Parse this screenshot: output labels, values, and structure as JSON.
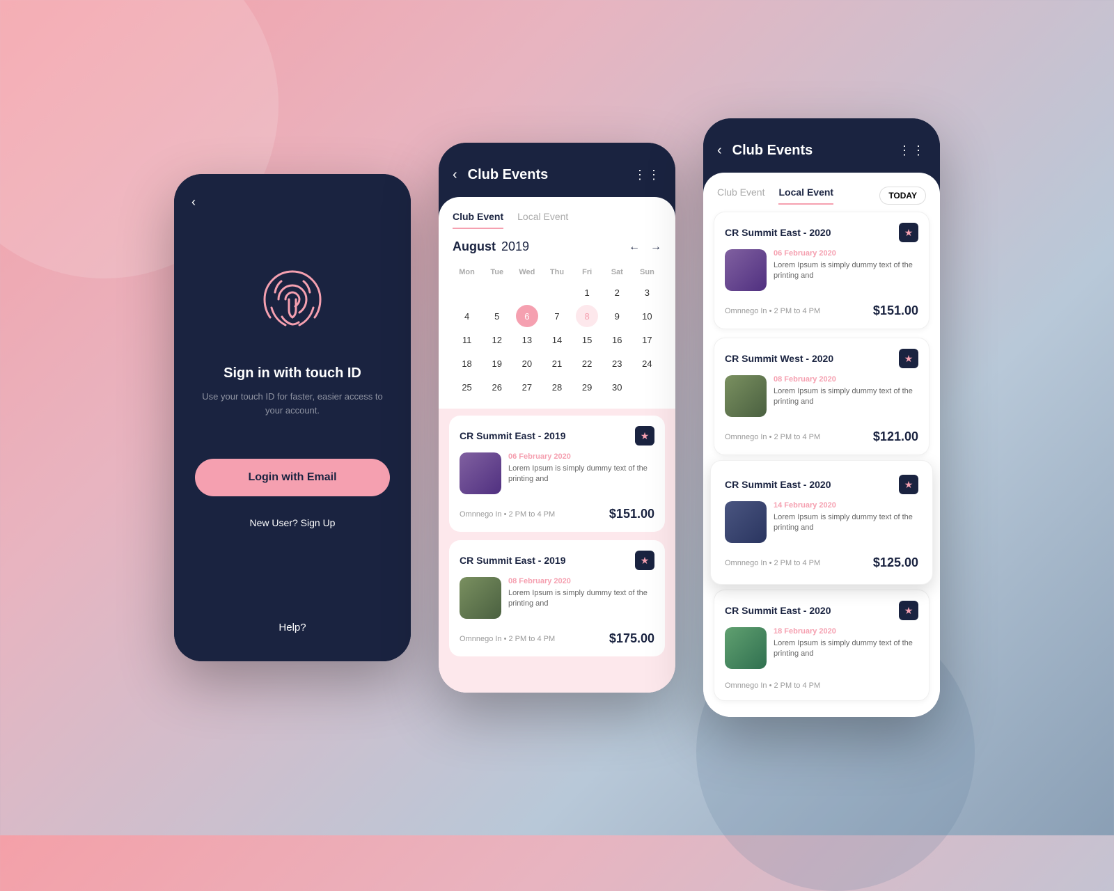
{
  "phone1": {
    "back_label": "‹",
    "sign_in_title": "Sign in with touch ID",
    "sign_in_subtitle": "Use your touch ID for faster, easier\naccess to your account.",
    "login_button": "Login with Email",
    "new_user_link": "New User? Sign Up",
    "help_link": "Help?"
  },
  "phone2": {
    "header": {
      "back": "‹",
      "title": "Club Events",
      "dots": "⋮⋮"
    },
    "tabs": [
      "Club Event",
      "Local Event"
    ],
    "calendar": {
      "month": "August",
      "year": "2019",
      "weekdays": [
        "Mon",
        "Tue",
        "Wed",
        "Thu",
        "Fri",
        "Sat",
        "Sun"
      ],
      "days": [
        {
          "day": "",
          "type": "empty"
        },
        {
          "day": "",
          "type": "empty"
        },
        {
          "day": "",
          "type": "empty"
        },
        {
          "day": "",
          "type": "empty"
        },
        {
          "day": "1",
          "type": "normal"
        },
        {
          "day": "2",
          "type": "normal"
        },
        {
          "day": "3",
          "type": "normal"
        },
        {
          "day": "4",
          "type": "normal"
        },
        {
          "day": "5",
          "type": "normal"
        },
        {
          "day": "6",
          "type": "highlighted"
        },
        {
          "day": "7",
          "type": "normal"
        },
        {
          "day": "8",
          "type": "highlighted-light"
        },
        {
          "day": "9",
          "type": "normal"
        },
        {
          "day": "10",
          "type": "normal"
        },
        {
          "day": "11",
          "type": "normal"
        },
        {
          "day": "12",
          "type": "normal"
        },
        {
          "day": "13",
          "type": "normal"
        },
        {
          "day": "14",
          "type": "normal"
        },
        {
          "day": "15",
          "type": "normal"
        },
        {
          "day": "16",
          "type": "normal"
        },
        {
          "day": "17",
          "type": "normal"
        },
        {
          "day": "18",
          "type": "normal"
        },
        {
          "day": "19",
          "type": "normal"
        },
        {
          "day": "20",
          "type": "normal"
        },
        {
          "day": "21",
          "type": "normal"
        },
        {
          "day": "22",
          "type": "normal"
        },
        {
          "day": "23",
          "type": "normal"
        },
        {
          "day": "24",
          "type": "normal"
        },
        {
          "day": "25",
          "type": "normal"
        },
        {
          "day": "26",
          "type": "normal"
        },
        {
          "day": "27",
          "type": "normal"
        },
        {
          "day": "28",
          "type": "normal"
        },
        {
          "day": "29",
          "type": "normal"
        },
        {
          "day": "30",
          "type": "normal"
        }
      ]
    },
    "events": [
      {
        "title": "CR Summit East - 2019",
        "date": "06 February 2020",
        "desc": "Lorem Ipsum is simply dummy text of the printing and",
        "location": "Omnnego In  •  2 PM to 4 PM",
        "price": "$151.00",
        "img_type": "crowd"
      },
      {
        "title": "CR Summit East - 2019",
        "date": "08 February 2020",
        "desc": "Lorem Ipsum is simply dummy text of the printing and",
        "location": "Omnnego In  •  2 PM to 4 PM",
        "price": "$175.00",
        "img_type": "outdoor"
      }
    ]
  },
  "phone3": {
    "header": {
      "back": "‹",
      "title": "Club Events",
      "dots": "⋮⋮"
    },
    "tabs": [
      "Club Event",
      "Local Event"
    ],
    "today_btn": "TODAY",
    "events": [
      {
        "title": "CR Summit East - 2020",
        "date": "06 February 2020",
        "desc": "Lorem Ipsum is simply dummy text of the printing and",
        "location": "Omnnego In  •  2 PM to 4 PM",
        "price": "$151.00",
        "img_type": "crowd",
        "elevated": false
      },
      {
        "title": "CR Summit West - 2020",
        "date": "08 February 2020",
        "desc": "Lorem Ipsum is simply dummy text of the printing and",
        "location": "Omnnego In  •  2 PM to 4 PM",
        "price": "$121.00",
        "img_type": "outdoor",
        "elevated": false
      },
      {
        "title": "CR Summit East - 2020",
        "date": "14 February 2020",
        "desc": "Lorem Ipsum is simply dummy text of the printing and",
        "location": "Omnnego In  •  2 PM to 4 PM",
        "price": "$125.00",
        "img_type": "dark",
        "elevated": true
      },
      {
        "title": "CR Summit East - 2020",
        "date": "18 February 2020",
        "desc": "Lorem Ipsum is simply dummy text of the printing and",
        "location": "Omnnego In  •  2 PM to 4 PM",
        "price": "",
        "img_type": "nature",
        "elevated": false
      }
    ]
  },
  "colors": {
    "accent": "#f5a0b0",
    "dark": "#1a2340",
    "pink_bg": "#fde8ec"
  }
}
